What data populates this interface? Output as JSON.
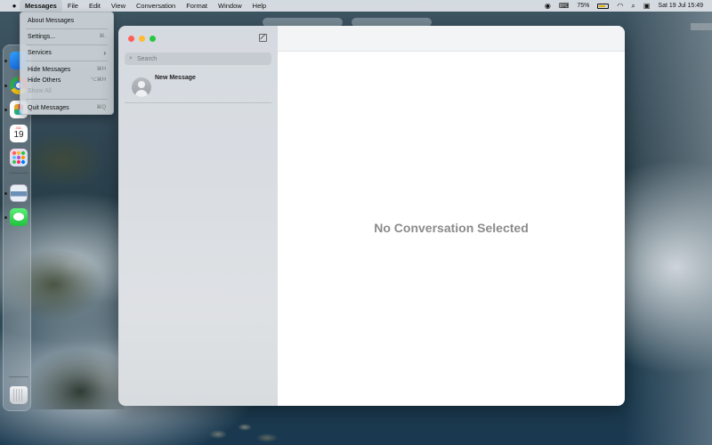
{
  "menubar": {
    "apple_icon": "apple-icon",
    "menus": [
      "Messages",
      "File",
      "Edit",
      "View",
      "Conversation",
      "Format",
      "Window",
      "Help"
    ],
    "status": {
      "battery_percent": "75%",
      "datetime": "Sat 19 Jul  15:49"
    }
  },
  "dropdown": {
    "items": [
      {
        "label": "About Messages",
        "shortcut": ""
      },
      {
        "label": "Settings...",
        "shortcut": "⌘,"
      },
      {
        "label": "Services",
        "shortcut": "›"
      },
      {
        "label": "Hide Messages",
        "shortcut": "⌘H"
      },
      {
        "label": "Hide Others",
        "shortcut": "⌥⌘H"
      },
      {
        "label": "Show All",
        "shortcut": ""
      },
      {
        "label": "Quit Messages",
        "shortcut": "⌘Q"
      }
    ]
  },
  "dock": {
    "calendar_month": "JUL",
    "calendar_day": "19"
  },
  "sidebar": {
    "search_placeholder": "Search",
    "conversations": [
      {
        "name": "New Message"
      }
    ]
  },
  "content": {
    "empty_state": "No Conversation Selected"
  }
}
